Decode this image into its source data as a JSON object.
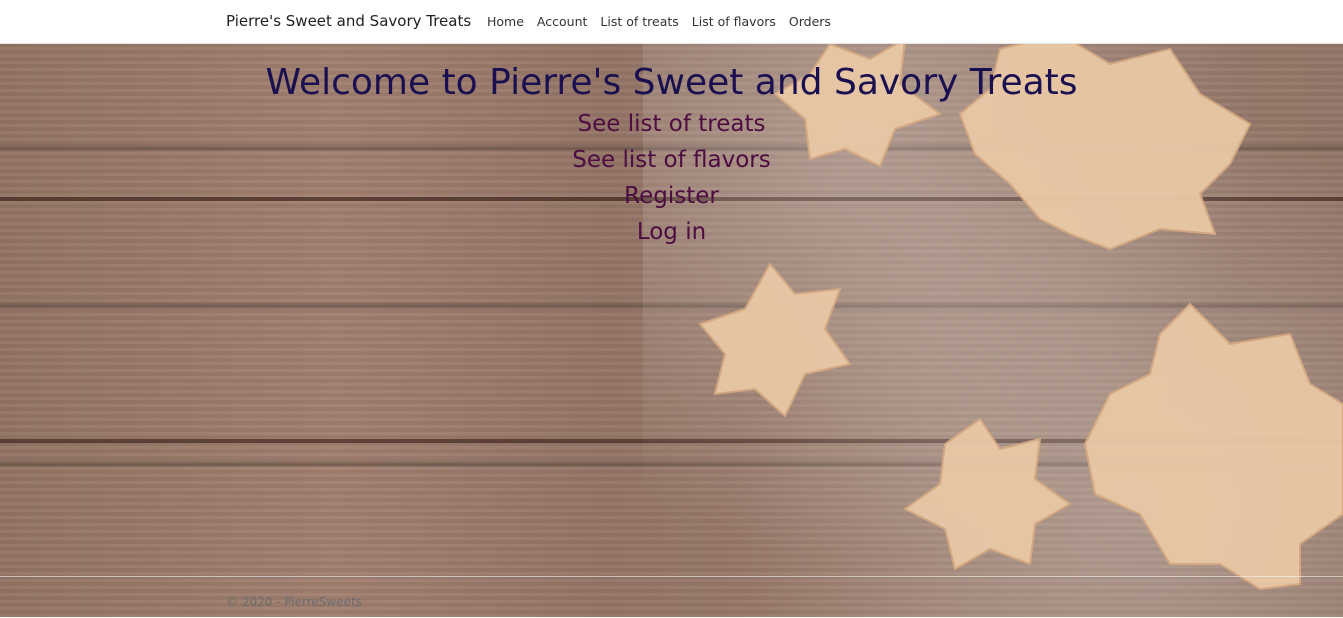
{
  "navbar": {
    "brand": "Pierre's Sweet and Savory Treats",
    "links": [
      "Home",
      "Account",
      "List of treats",
      "List of flavors",
      "Orders"
    ]
  },
  "main": {
    "headline": "Welcome to Pierre's Sweet and Savory Treats",
    "links": [
      "See list of treats",
      "See list of flavors",
      "Register",
      "Log in"
    ]
  },
  "footer": {
    "text": "© 2020 - PierreSweets"
  },
  "colors": {
    "headline": "#1a1050",
    "links": "#4d0c42",
    "wood": "#7a5541"
  },
  "background_image": "wooden table with sugar-dusted star cookies"
}
